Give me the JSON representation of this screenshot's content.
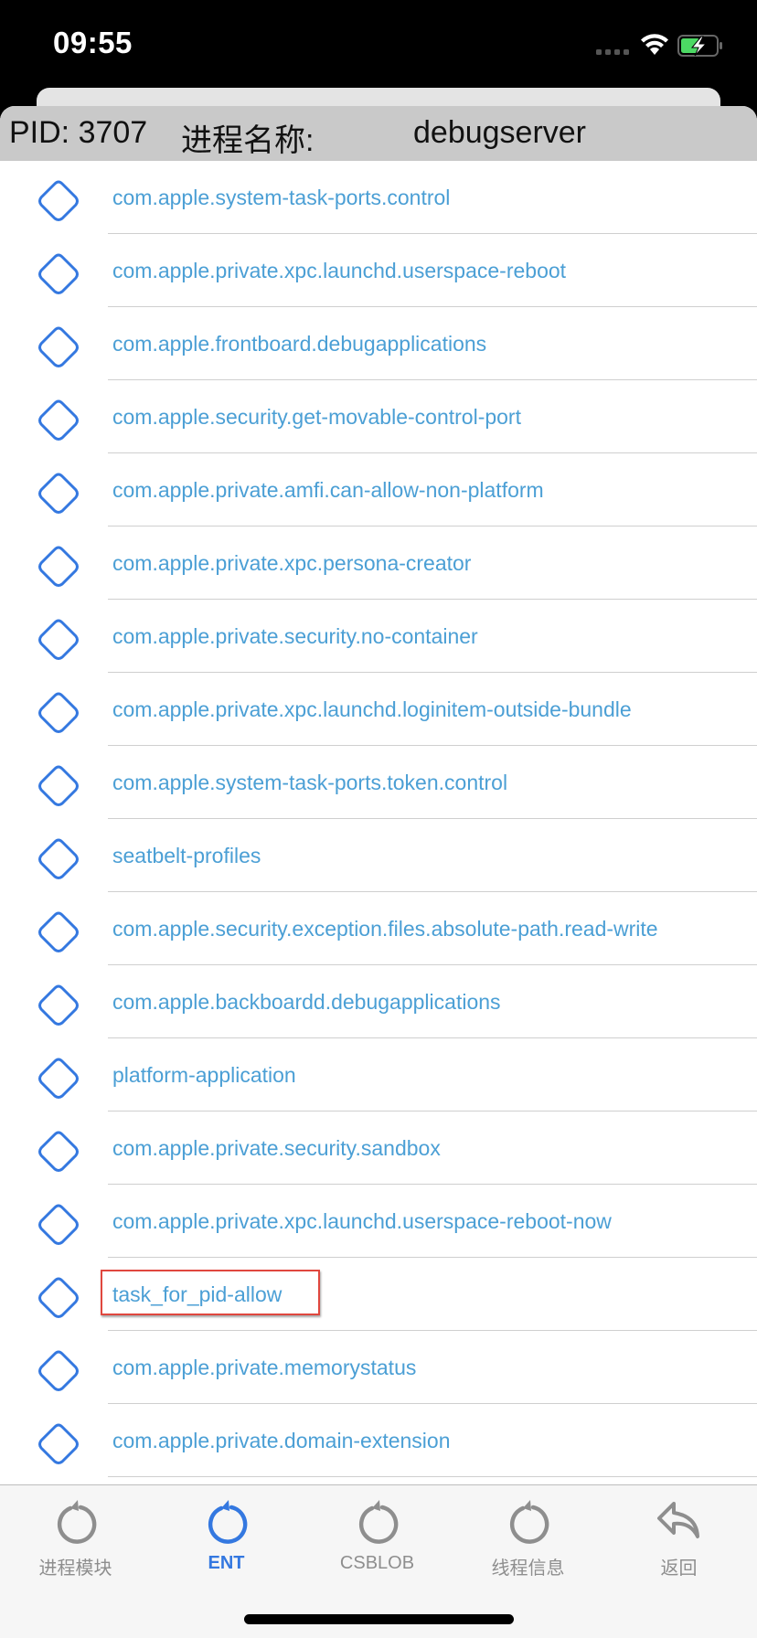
{
  "status_bar": {
    "time": "09:55",
    "wifi_icon": "wifi-icon",
    "battery_icon": "battery-charging-icon",
    "signal_icon": "cellular-signal-icon"
  },
  "header": {
    "pid": "PID: 3707",
    "process_name_label": "进程名称:",
    "process_name": "debugserver"
  },
  "list": {
    "item_icon": "diamond-icon",
    "highlighted_index": 15,
    "items": [
      {
        "label": "com.apple.system-task-ports.control"
      },
      {
        "label": "com.apple.private.xpc.launchd.userspace-reboot"
      },
      {
        "label": "com.apple.frontboard.debugapplications"
      },
      {
        "label": "com.apple.security.get-movable-control-port"
      },
      {
        "label": "com.apple.private.amfi.can-allow-non-platform"
      },
      {
        "label": "com.apple.private.xpc.persona-creator"
      },
      {
        "label": "com.apple.private.security.no-container"
      },
      {
        "label": "com.apple.private.xpc.launchd.loginitem-outside-bundle"
      },
      {
        "label": "com.apple.system-task-ports.token.control"
      },
      {
        "label": "seatbelt-profiles"
      },
      {
        "label": "com.apple.security.exception.files.absolute-path.read-write"
      },
      {
        "label": "com.apple.backboardd.debugapplications"
      },
      {
        "label": "platform-application"
      },
      {
        "label": "com.apple.private.security.sandbox"
      },
      {
        "label": "com.apple.private.xpc.launchd.userspace-reboot-now"
      },
      {
        "label": "task_for_pid-allow"
      },
      {
        "label": "com.apple.private.memorystatus"
      },
      {
        "label": "com.apple.private.domain-extension"
      }
    ]
  },
  "tabbar": {
    "active_index": 1,
    "active_color": "#3478e0",
    "inactive_color": "#8e8e8e",
    "tabs": [
      {
        "label": "进程模块",
        "icon": "refresh-icon"
      },
      {
        "label": "ENT",
        "icon": "refresh-icon"
      },
      {
        "label": "CSBLOB",
        "icon": "refresh-icon"
      },
      {
        "label": "线程信息",
        "icon": "refresh-icon"
      },
      {
        "label": "返回",
        "icon": "back-arrow-icon"
      }
    ]
  },
  "colors": {
    "link_text": "#4b9fd5",
    "diamond_stroke": "#3478e0",
    "header_bg": "#c9c9c9",
    "highlight_border": "#e0473e"
  }
}
